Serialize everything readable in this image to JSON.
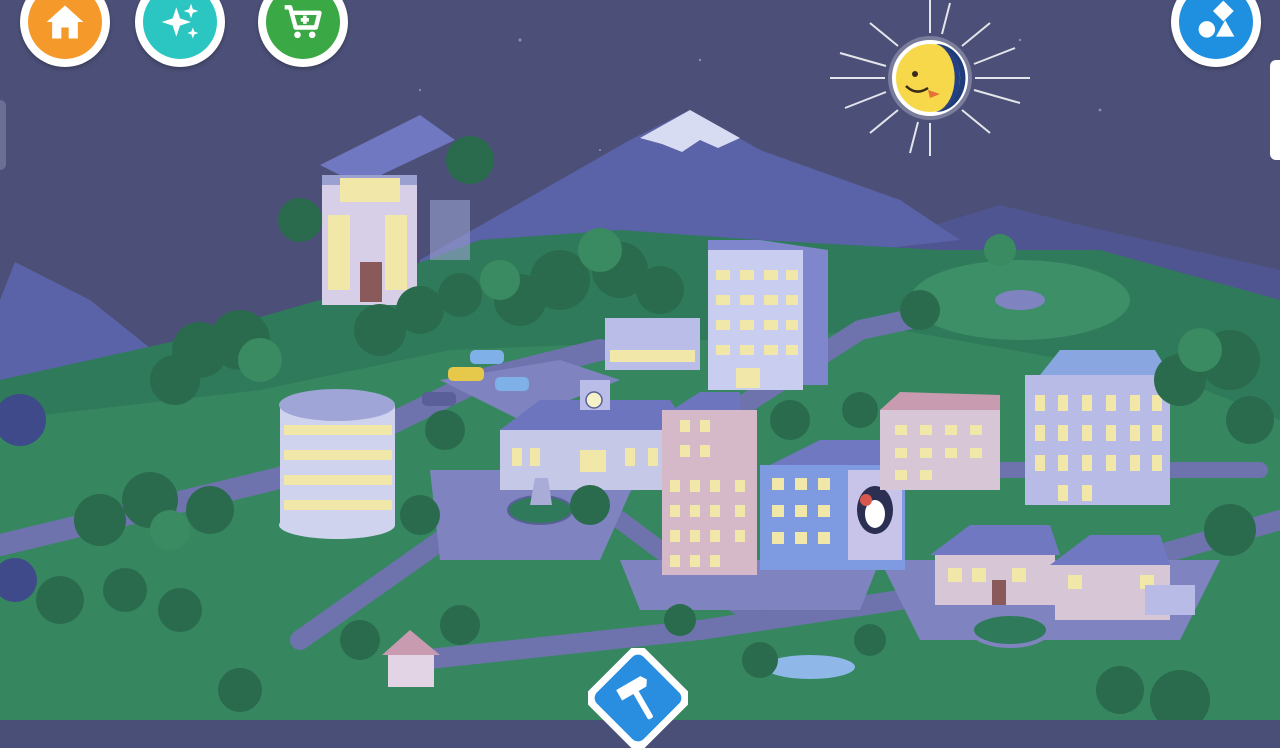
{
  "game": {
    "scene": "town-map-night",
    "time_of_day": "night"
  },
  "toolbar": {
    "home": {
      "icon": "home-icon",
      "color": "#f59a2a"
    },
    "sparkle": {
      "icon": "sparkle-icon",
      "color": "#2cc6c2"
    },
    "shop": {
      "icon": "shopping-cart-icon",
      "color": "#3aa845"
    },
    "shapes": {
      "icon": "shapes-icon",
      "color": "#1f8fe0"
    }
  },
  "build_button": {
    "icon": "hammer-icon",
    "color": "#2a8ee0"
  },
  "colors": {
    "sky": "#4c5078",
    "mountain": "#5c63a0",
    "grass": "#2f7a5a",
    "road": "#6f73ad",
    "window_light": "#f1e7a8"
  }
}
